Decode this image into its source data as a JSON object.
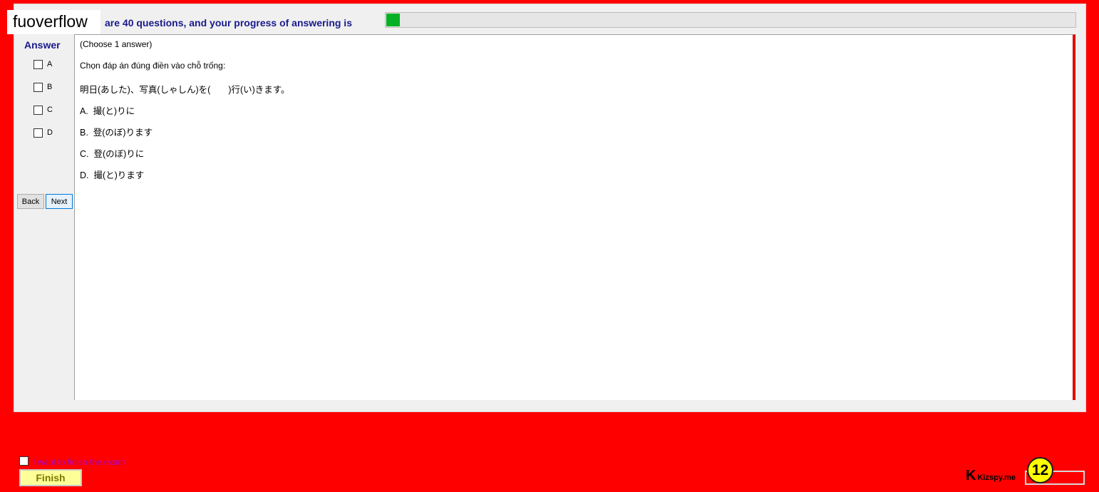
{
  "brand": "fuoverflow",
  "header": {
    "progress_text": "are 40 questions, and your progress of answering is",
    "progress_fraction": 0.02
  },
  "sidebar": {
    "answer_label": "Answer",
    "options": [
      "A",
      "B",
      "C",
      "D"
    ],
    "back_label": "Back",
    "next_label": "Next"
  },
  "question": {
    "instruction": "(Choose 1 answer)",
    "prompt": "Chọn đáp án đúng điền vào chỗ trống:",
    "sentence": "明日(あした)、写真(しゃしん)を(　　)行(い)きます。",
    "choices": [
      "A.  撮(と)りに",
      "B.  登(のぼ)ります",
      "C.  登(のぼ)りに",
      "D.  撮(と)ります"
    ]
  },
  "footer": {
    "finish_checkbox_label": "I want to finish the exam",
    "finish_label": "Finish",
    "kizspy_k": "K",
    "kizspy_text": "Kizspy.me",
    "badge_number": "12"
  },
  "colors": {
    "background": "#ff0000",
    "progress_fill": "#06b025",
    "header_text": "#1a1a8c",
    "finish_button": "#ffff99",
    "badge": "#ffff00"
  }
}
